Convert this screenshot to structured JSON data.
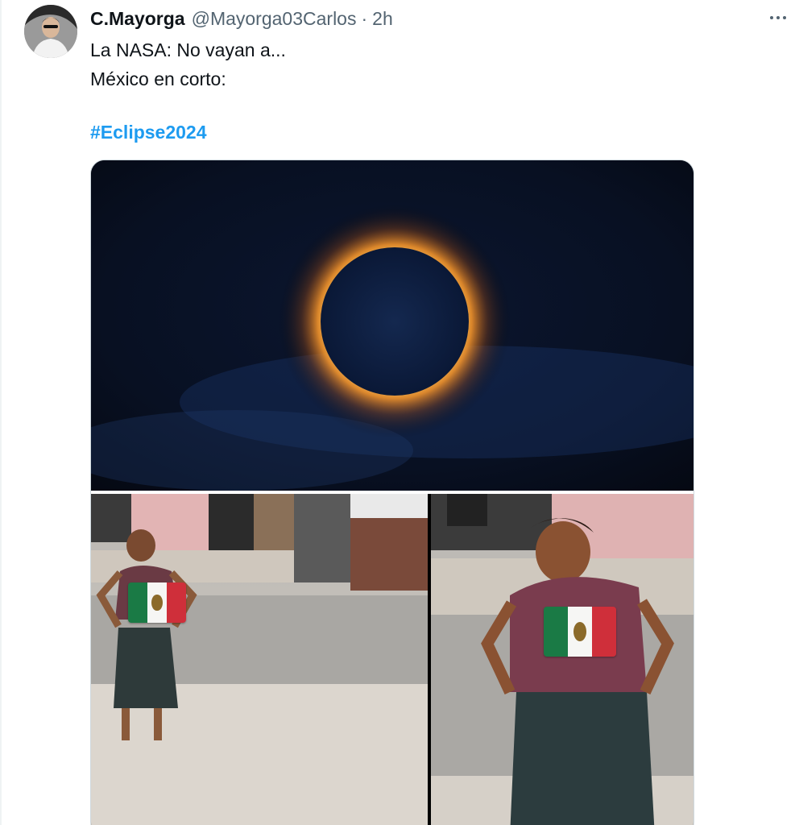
{
  "tweet": {
    "display_name": "C.Mayorga",
    "handle": "@Mayorga03Carlos",
    "separator": "·",
    "timestamp": "2h",
    "text_lines": [
      "La NASA: No vayan a...",
      "México en corto:"
    ],
    "hashtag": "#Eclipse2024",
    "more_icon": "more-horizontal-icon"
  },
  "colors": {
    "link": "#1d9bf0",
    "secondary_text": "#536471",
    "primary_text": "#0f1419",
    "flag_green": "#1a7a45",
    "flag_white": "#f6f6f4",
    "flag_red": "#cf2f3a"
  }
}
